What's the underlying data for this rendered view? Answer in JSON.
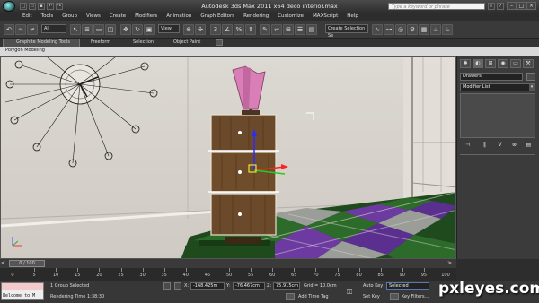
{
  "app": {
    "title": "Autodesk 3ds Max  2011 x64      deco interior.max",
    "search_placeholder": "Type a keyword or phrase"
  },
  "menu": [
    "Edit",
    "Tools",
    "Group",
    "Views",
    "Create",
    "Modifiers",
    "Animation",
    "Graph Editors",
    "Rendering",
    "Customize",
    "MAXScript",
    "Help"
  ],
  "toolbar": {
    "selection_filter": "All",
    "ref_coord": "View",
    "named_selection": "Create Selection Se"
  },
  "ribbon": {
    "tabs": [
      "Graphite Modeling Tools",
      "Freeform",
      "Selection",
      "Object Paint"
    ],
    "active_panel": "Polygon Modeling"
  },
  "command_panel": {
    "object_name": "Drawers",
    "modifier_list": "Modifier List"
  },
  "time_slider": {
    "frame": "0 / 100"
  },
  "timeline_ticks": [
    "0",
    "5",
    "10",
    "15",
    "20",
    "25",
    "30",
    "35",
    "40",
    "45",
    "50",
    "55",
    "60",
    "65",
    "70",
    "75",
    "80",
    "85",
    "90",
    "95",
    "100"
  ],
  "status": {
    "listener_text": "Welcome to M",
    "message": "1 Group Selected",
    "render_time": "Rendering Time  1:38:30",
    "x_label": "X:",
    "x_value": "-168.425m",
    "y_label": "Y:",
    "y_value": "-76.467cm",
    "z_label": "Z:",
    "z_value": "75.915cm",
    "grid": "Grid = 10.0cm",
    "add_time_tag": "Add Time Tag",
    "auto_key": "Auto Key",
    "set_key": "Set Key",
    "key_mode": "Selected",
    "key_filters": "Key Filters..."
  },
  "watermark": "pxleyes.com",
  "colors": {
    "floor_purple": "#5b2f8f",
    "floor_green": "#2d6b2a",
    "lamp_pink": "#d97fb5",
    "drawer_wood": "#6a4a2a"
  }
}
